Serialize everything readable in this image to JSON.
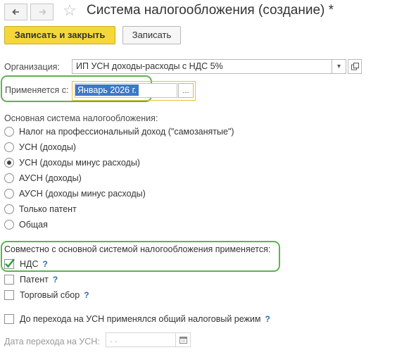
{
  "window": {
    "title": "Система налогообложения (создание) *",
    "icons": {
      "back": "arrow-left-icon",
      "forward": "arrow-right-icon",
      "favorite": "star-icon"
    }
  },
  "toolbar": {
    "save_close_label": "Записать и закрыть",
    "save_label": "Записать"
  },
  "organization": {
    "label": "Организация:",
    "value": "ИП УСН доходы-расходы с НДС 5%"
  },
  "applies_from": {
    "label": "Применяется с:",
    "value": "Январь 2026 г.",
    "select_button": "..."
  },
  "main_system": {
    "heading": "Основная система налогообложения:",
    "options": [
      {
        "label": "Налог на профессиональный доход (\"самозанятые\")",
        "checked": false
      },
      {
        "label": "УСН (доходы)",
        "checked": false
      },
      {
        "label": "УСН (доходы минус расходы)",
        "checked": true
      },
      {
        "label": "АУСН (доходы)",
        "checked": false
      },
      {
        "label": "АУСН (доходы минус расходы)",
        "checked": false
      },
      {
        "label": "Только патент",
        "checked": false
      },
      {
        "label": "Общая",
        "checked": false
      }
    ]
  },
  "combined": {
    "heading": "Совместно с основной системой налогообложения применяется:",
    "items": [
      {
        "label": "НДС",
        "checked": true,
        "help": "?"
      },
      {
        "label": "Патент",
        "checked": false,
        "help": "?"
      },
      {
        "label": "Торговый сбор",
        "checked": false,
        "help": "?"
      }
    ]
  },
  "general_before_usn": {
    "label": "До перехода на УСН применялся общий налоговый режим",
    "checked": false,
    "help": "?"
  },
  "transition_date": {
    "label": "Дата перехода на УСН:",
    "value": " .  ."
  },
  "colors": {
    "primary_button": "#f5d73a",
    "highlight_green": "#59b74a",
    "highlight_yellow": "#e8c23a",
    "selection": "#3b78c8",
    "help": "#2d6aa8"
  }
}
